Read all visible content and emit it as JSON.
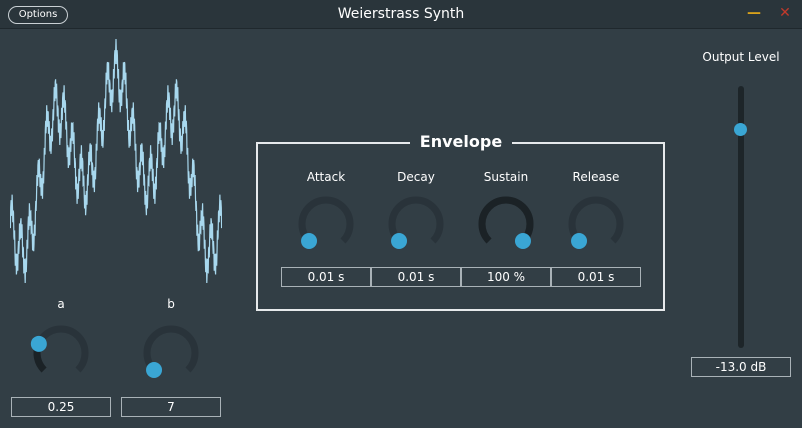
{
  "window": {
    "title": "Weierstrass Synth",
    "options_label": "Options",
    "minimize_icon": "minimize-icon",
    "close_icon": "close-icon",
    "accent_color": "#3aa6d4",
    "background_color": "#323e45"
  },
  "params": {
    "a": {
      "label": "a",
      "value": "0.25",
      "level": 0.25
    },
    "b": {
      "label": "b",
      "value": "7",
      "level": 0.0
    }
  },
  "envelope": {
    "title": "Envelope",
    "attack": {
      "label": "Attack",
      "value": "0.01 s",
      "level": 0.0
    },
    "decay": {
      "label": "Decay",
      "value": "0.01 s",
      "level": 0.0
    },
    "sustain": {
      "label": "Sustain",
      "value": "100 %",
      "level": 1.0
    },
    "release": {
      "label": "Release",
      "value": "0.01 s",
      "level": 0.0
    }
  },
  "output": {
    "label": "Output Level",
    "value": "-13.0 dB",
    "level": 0.85
  }
}
